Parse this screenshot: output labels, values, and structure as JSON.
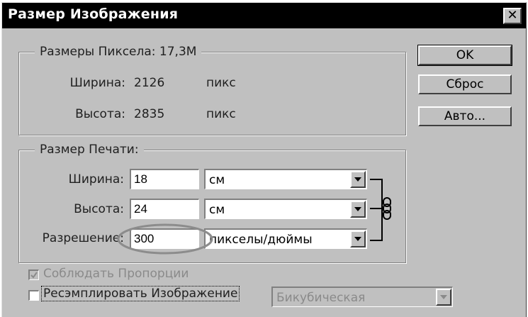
{
  "dialog": {
    "title": "Размер Изображения",
    "close_glyph": "✕"
  },
  "pixel_dimensions": {
    "legend": "Размеры Пиксела: 17,3М",
    "width_label": "Ширина:",
    "width_value": "2126",
    "width_unit": "пикс",
    "height_label": "Высота:",
    "height_value": "2835",
    "height_unit": "пикс"
  },
  "print_size": {
    "legend": "Размер Печати:",
    "width_label": "Ширина:",
    "width_value": "18",
    "width_unit": "см",
    "height_label": "Высота:",
    "height_value": "24",
    "height_unit": "см",
    "resolution_label": "Разрешение:",
    "resolution_value": "300",
    "resolution_unit": "пикселы/дюймы",
    "link_icon": "chain-link"
  },
  "options": {
    "constrain_label": "Соблюдать Пропорции",
    "constrain_checked": true,
    "constrain_enabled": false,
    "resample_label": "Ресэмплировать Изображение",
    "resample_checked": false,
    "resample_method": "Бикубическая"
  },
  "buttons": {
    "ok": "OK",
    "reset": "Сброс",
    "auto": "Авто..."
  },
  "colors": {
    "dialog_bg": "#c0c0c0",
    "titlebar_bg": "#000000",
    "highlight_ellipse": "#8c8c8c",
    "disabled_text": "#8a8a8a"
  }
}
